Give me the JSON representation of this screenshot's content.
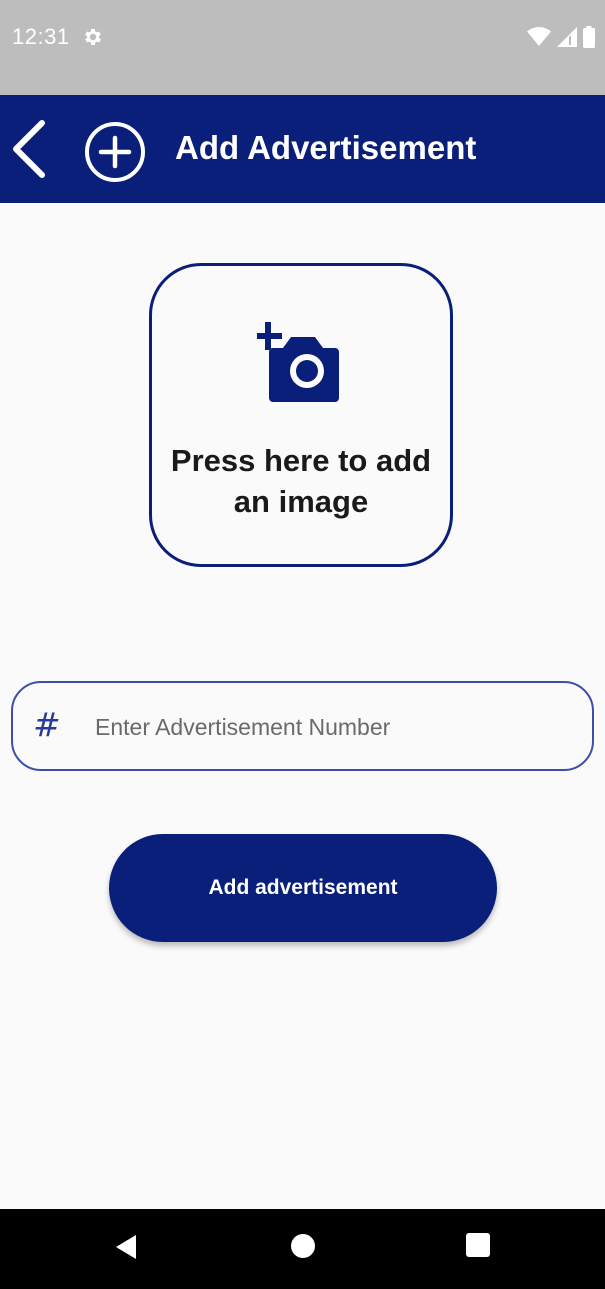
{
  "status_bar": {
    "time": "12:31",
    "icons": [
      "gear-icon",
      "wifi-icon",
      "signal-icon",
      "battery-icon"
    ]
  },
  "app_bar": {
    "title": "Add Advertisement",
    "back_icon": "chevron-left-icon",
    "title_icon": "add-circle-icon",
    "background_color": "#0a1f7a"
  },
  "image_picker": {
    "icon": "add-a-photo-icon",
    "label": "Press here to add an image"
  },
  "advertisement_number_field": {
    "icon": "hash-icon",
    "icon_glyph": "#",
    "placeholder": "Enter Advertisement Number",
    "value": ""
  },
  "submit_button": {
    "label": "Add advertisement"
  },
  "nav_bar": {
    "buttons": [
      "back-triangle-icon",
      "home-circle-icon",
      "recents-square-icon"
    ]
  },
  "colors": {
    "accent": "#0a1f7a",
    "status_bar": "#bdbdbd",
    "background": "#fafafa"
  }
}
